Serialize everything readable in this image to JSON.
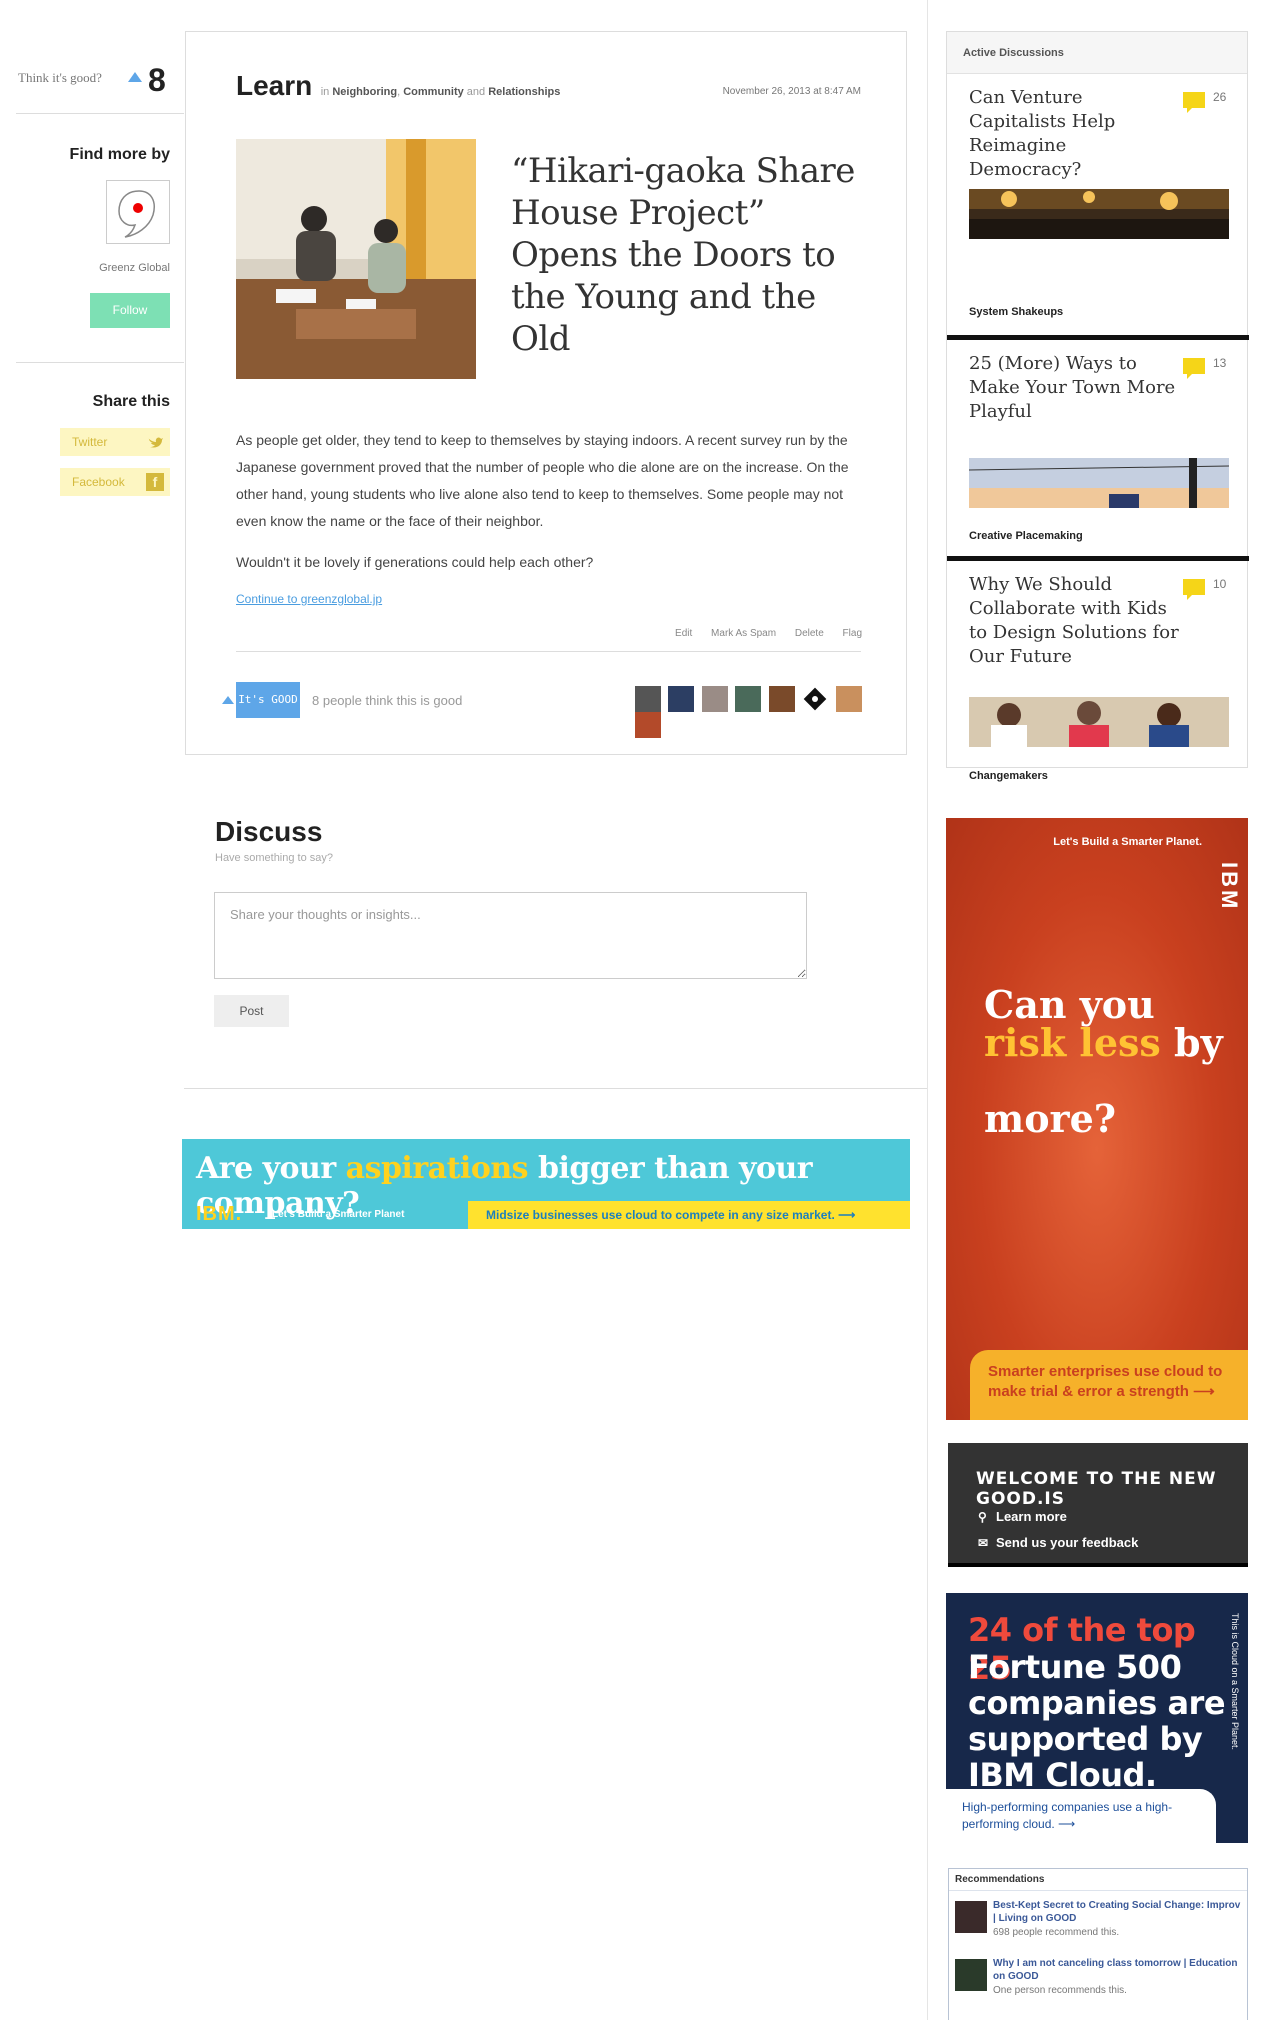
{
  "left": {
    "think_prompt": "Think it's good?",
    "think_count": "8",
    "find_more": "Find more by",
    "author": "Greenz Global",
    "follow": "Follow",
    "share_title": "Share this",
    "twitter": "Twitter",
    "facebook": "Facebook"
  },
  "article": {
    "category": "Learn",
    "in_word": "in",
    "tag1": "Neighboring",
    "tag2": "Community",
    "and_word": "and",
    "tag3": "Relationships",
    "date": "November 26, 2013 at 8:47 AM",
    "title": "“Hikari-gaoka Share House Project” Opens the Doors to the Young and the Old",
    "para1": "As people get older, they tend to keep to themselves by staying indoors. A recent survey run by the Japanese government proved that the number of people who die alone are on the increase. On the other hand, young students who live alone also tend to keep to themselves. Some people may not even know the name or the face of their neighbor.",
    "para2": "Wouldn't it be lovely if generations could help each other?",
    "continue": "Continue to greenzglobal.jp",
    "edit": "Edit",
    "spam": "Mark As Spam",
    "delete": "Delete",
    "flag": "Flag",
    "good_btn": "It's GOOD",
    "good_count": "8 people think this is good"
  },
  "discuss": {
    "title": "Discuss",
    "subtitle": "Have something to say?",
    "placeholder": "Share your thoughts or insights...",
    "post": "Post"
  },
  "banner_wide": {
    "pre": "Are your ",
    "highlight": "aspirations",
    "post": " bigger than your company?",
    "logo": "IBM.",
    "tagline": "Let's Build a Smarter Planet",
    "strip": "Midsize businesses use cloud to compete in any size market.  ⟶"
  },
  "active": {
    "header": "Active Discussions",
    "items": [
      {
        "title": "Can Venture Capitalists Help Reimagine Democracy?",
        "count": "26",
        "category": "System Shakeups"
      },
      {
        "title": "25 (More) Ways to Make Your Town More Playful",
        "count": "13",
        "category": "Creative Placemaking"
      },
      {
        "title": "Why We Should Collaborate with Kids to Design Solutions for Our Future",
        "count": "10",
        "category": "Changemakers"
      }
    ]
  },
  "ibm_tall": {
    "top": "Let's Build a Smarter Planet.",
    "logo": "IBM",
    "line1": "Can you",
    "line2_hl": "risk less",
    "line2_rest": " by",
    "line3": "more?",
    "foot": "Smarter enterprises use cloud to make trial & error a strength ⟶"
  },
  "welcome": {
    "title": "WELCOME TO THE NEW GOOD.IS",
    "learn": "Learn more",
    "feedback": "Send us your feedback"
  },
  "ibm_cloud": {
    "red": "24 of the top 25",
    "white": "Fortune 500 companies are supported by IBM Cloud.",
    "side": "This is Cloud on a Smarter Planet.",
    "foot": "High-performing companies use a high-performing cloud. ⟶"
  },
  "recs": {
    "header": "Recommendations",
    "items": [
      {
        "title": "Best-Kept Secret to Creating Social Change: Improv | Living on GOOD",
        "meta": "698 people recommend this."
      },
      {
        "title": "Why I am not canceling class tomorrow | Education on GOOD",
        "meta": "One person recommends this."
      }
    ]
  },
  "colors": {
    "accent_blue": "#5ea6e8",
    "follow_green": "#7de0b4",
    "comment_yellow": "#f5d518",
    "ibm_red": "#c9401f"
  }
}
